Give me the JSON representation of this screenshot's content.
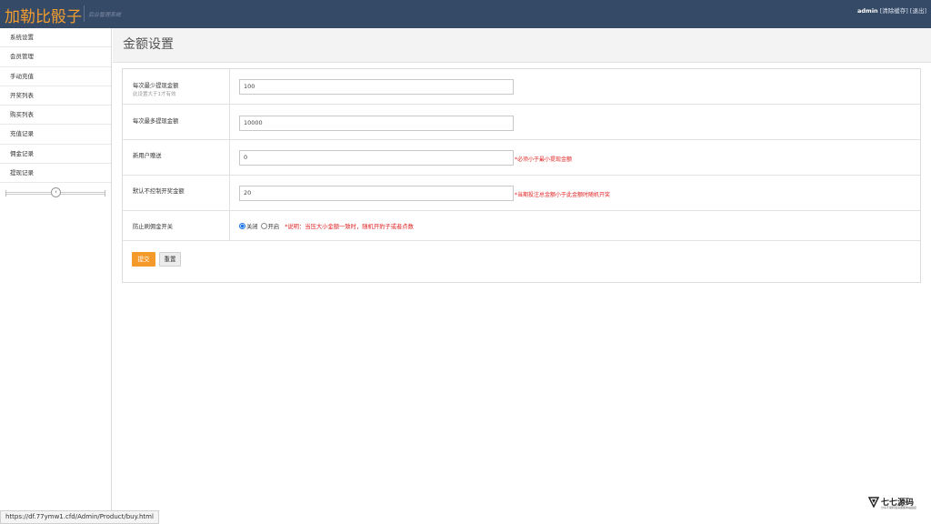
{
  "header": {
    "app_title": "加勒比骰子",
    "subtitle": "后台管理系统",
    "username": "admin",
    "clear_cache": "[清除缓存]",
    "logout": "[退出]"
  },
  "sidebar": {
    "items": [
      {
        "label": "系统设置"
      },
      {
        "label": "会员管理"
      },
      {
        "label": "手动充值"
      },
      {
        "label": "开奖列表"
      },
      {
        "label": "购买列表"
      },
      {
        "label": "充值记录"
      },
      {
        "label": "佣金记录"
      },
      {
        "label": "提现记录"
      }
    ],
    "collapse_icon": "chevron-left-icon"
  },
  "main": {
    "title": "金额设置",
    "fields": [
      {
        "label": "每次最少提现金额",
        "note": "此设置大于1才有效",
        "value": "100",
        "hint": ""
      },
      {
        "label": "每次最多提现金额",
        "note": "",
        "value": "10000",
        "hint": ""
      },
      {
        "label": "新用户赠送",
        "note": "",
        "value": "0",
        "hint": "*必须小于最小提现金额"
      },
      {
        "label": "默认不控制开奖金额",
        "note": "",
        "value": "20",
        "hint": "*当期投注总金额小于此金额时随机开奖"
      }
    ],
    "switch": {
      "label": "防止刷佣金开关",
      "options": [
        "关闭",
        "开启"
      ],
      "selected": "关闭",
      "hint": "*说明：当压大小金额一致时，随机开豹子或者点数"
    },
    "buttons": {
      "submit": "提交",
      "reset": "重置"
    }
  },
  "statusbar": {
    "url": "https://df.77ymw1.cfd/Admin/Product/buy.html"
  },
  "watermark": {
    "name": "七七源码",
    "tagline": "分享不易转载请保留本站链接"
  },
  "colors": {
    "topbar": "#354a67",
    "brand": "#f39c2f",
    "submit": "#f39a2b",
    "hint": "#e02222"
  }
}
